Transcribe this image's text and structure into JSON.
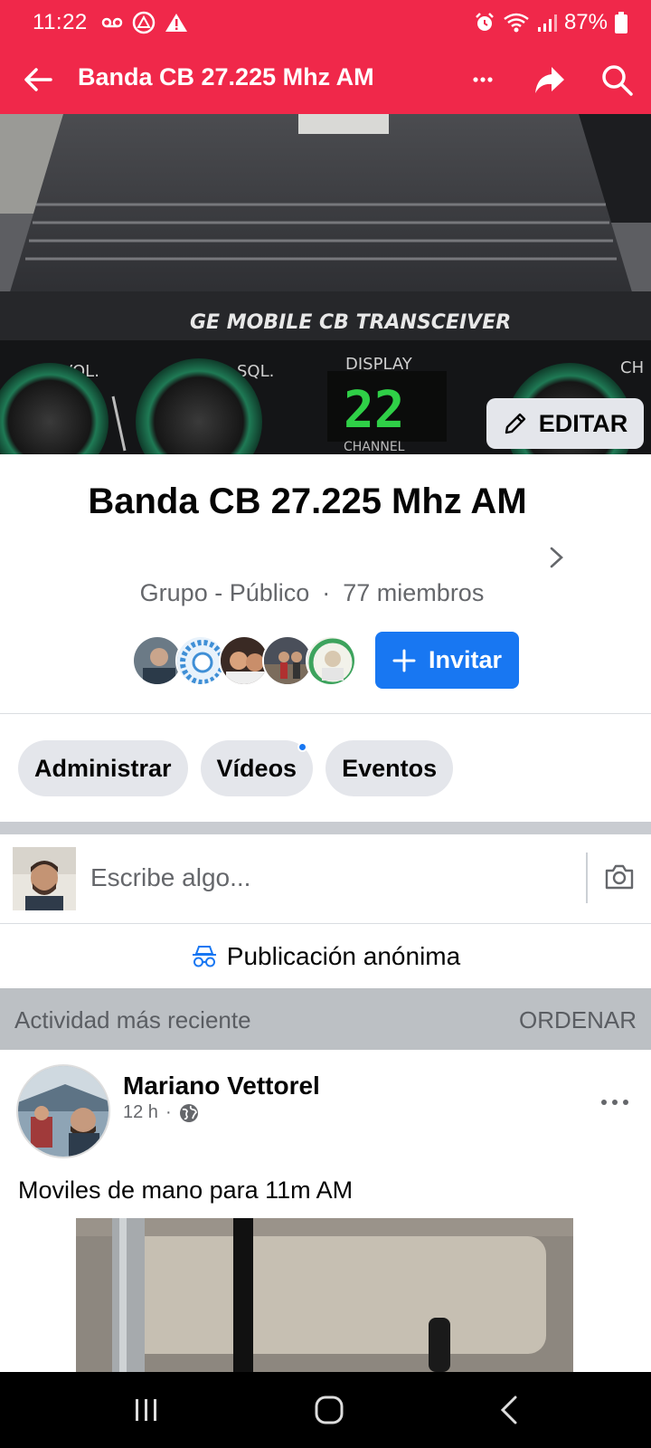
{
  "status_bar": {
    "time": "11:22",
    "battery": "87%"
  },
  "app_bar": {
    "title": "Banda CB 27.225 Mhz AM",
    "color": "#f0284a"
  },
  "cover": {
    "edit_label": "EDITAR"
  },
  "group": {
    "name": "Banda CB 27.225 Mhz AM",
    "privacy": "Grupo - Público",
    "separator": "·",
    "members": "77 miembros",
    "invite_label": "Invitar"
  },
  "chips": [
    {
      "label": "Administrar"
    },
    {
      "label": "Vídeos",
      "badge": true
    },
    {
      "label": "Eventos"
    }
  ],
  "composer": {
    "placeholder": "Escribe algo..."
  },
  "anonymous": {
    "label": "Publicación anónima"
  },
  "activity": {
    "label": "Actividad más reciente",
    "sort_label": "ORDENAR"
  },
  "post": {
    "author": "Mariano Vettorel",
    "time": "12 h",
    "separator": "·",
    "text": "Moviles de mano para 11m AM"
  },
  "colors": {
    "accent": "#1877f2",
    "brand_red": "#f0284a"
  }
}
